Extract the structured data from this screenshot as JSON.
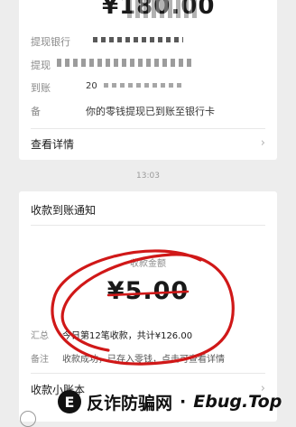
{
  "top_card": {
    "amount": "¥180.00",
    "rows": [
      {
        "label": "提现银行"
      },
      {
        "label": "提现"
      },
      {
        "label": "到账",
        "value": "20"
      },
      {
        "label": "备",
        "value": "你的零钱提现已到账至银行卡"
      }
    ],
    "view_details": "查看详情"
  },
  "timestamp": "13:03",
  "notice": {
    "title": "收款到账通知",
    "amount_label": "收款金额",
    "amount": "¥5.00",
    "summary_label": "汇总",
    "summary_value": "今日第12笔收款，共计¥126.00",
    "note_label": "备注",
    "note_value": "收款成功，已存入零钱，点击可查看详情",
    "ledger_link": "收款小账本"
  },
  "watermark": {
    "logo_char": "E",
    "text_cn": "反诈防骗网",
    "text_en": "Ebug.Top"
  },
  "colors": {
    "annotation": "#d01818",
    "background": "#ededed",
    "card": "#ffffff"
  }
}
